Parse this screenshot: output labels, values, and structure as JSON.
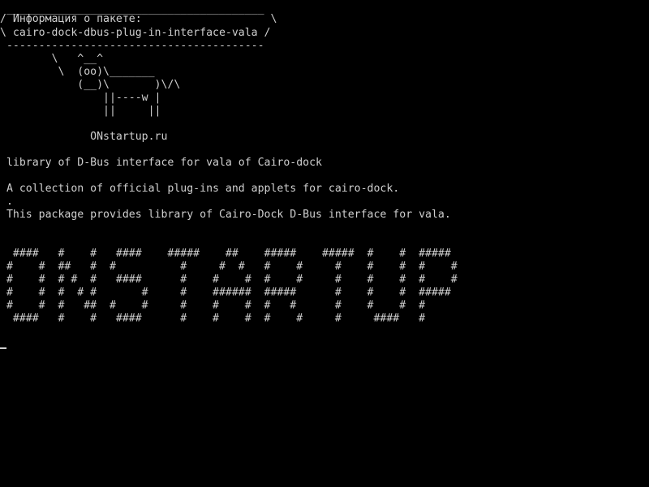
{
  "terminal": {
    "colors": {
      "background": "#000000",
      "foreground": "#cfcfcf"
    },
    "bubble": {
      "top_border": " ________________________________________",
      "line1": "/ Информация о пакете:                    \\",
      "line2": "\\ cairo-dock-dbus-plug-in-interface-vala /",
      "bottom_border": " ----------------------------------------"
    },
    "cow": [
      "        \\   ^__^",
      "         \\  (oo)\\_______",
      "            (__)\\       )\\/\\",
      "                ||----w |",
      "                ||     ||"
    ],
    "site": "              ONstartup.ru",
    "summary": " library of D-Bus interface for vala of Cairo-dock",
    "description_line1": " A collection of official plug-ins and applets for cairo-dock.",
    "description_dot": " .",
    "description_line2": " This package provides library of Cairo-Dock D-Bus interface for vala.",
    "banner": [
      "  ####   #    #   ####    #####    ##    #####    #####  #    #  #####",
      " #    #  ##   #  #          #     #  #   #    #     #    #    #  #    #",
      " #    #  # #  #   ####      #    #    #  #    #     #    #    #  #    #",
      " #    #  #  # #       #     #    ######  #####      #    #    #  #####",
      " #    #  #   ##  #    #     #    #    #  #   #      #    #    #  #",
      "  ####   #    #   ####      #    #    #  #    #     #     ####   #"
    ]
  }
}
